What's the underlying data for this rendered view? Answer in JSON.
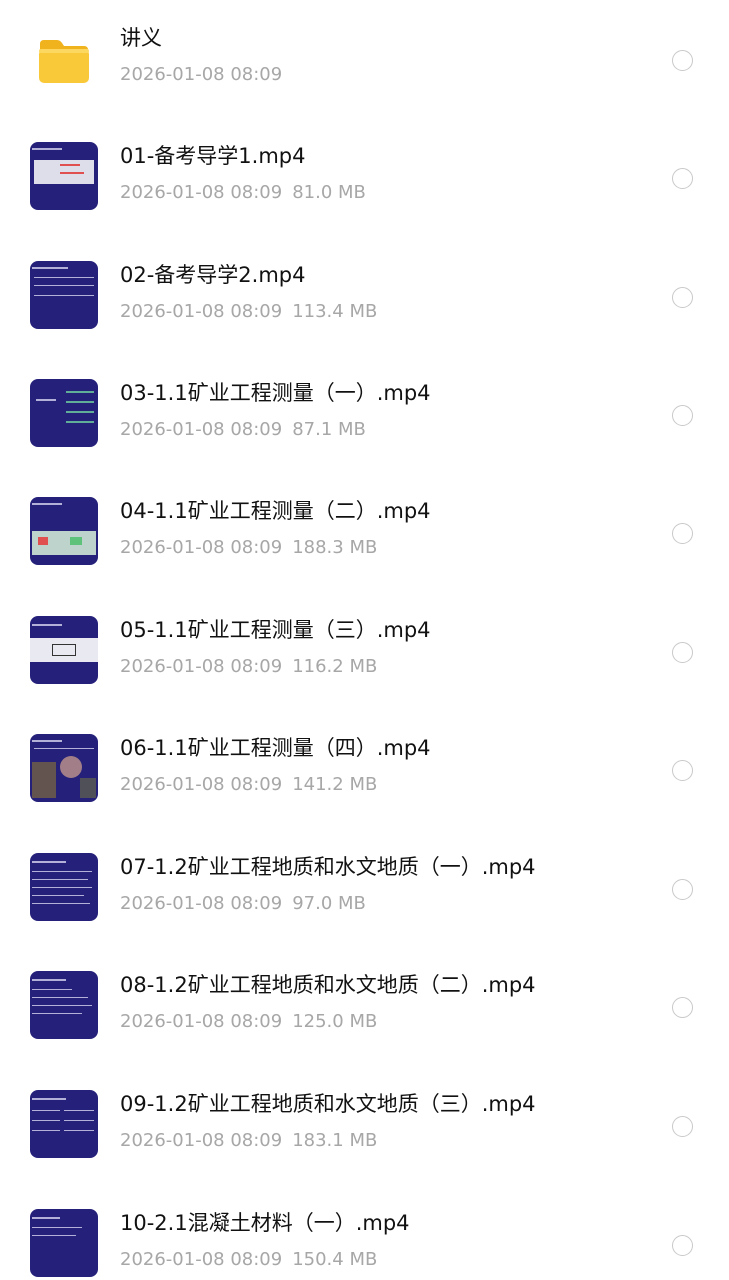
{
  "items": [
    {
      "name": "讲义",
      "date": "2026-01-08 08:09",
      "size": "",
      "type": "folder-icon"
    },
    {
      "name": "01-备考导学1.mp4",
      "date": "2026-01-08 08:09",
      "size": "81.0 MB",
      "type": "video-thumbnail"
    },
    {
      "name": "02-备考导学2.mp4",
      "date": "2026-01-08 08:09",
      "size": "113.4 MB",
      "type": "video-thumbnail"
    },
    {
      "name": "03-1.1矿业工程测量（一）.mp4",
      "date": "2026-01-08 08:09",
      "size": "87.1 MB",
      "type": "video-thumbnail"
    },
    {
      "name": "04-1.1矿业工程测量（二）.mp4",
      "date": "2026-01-08 08:09",
      "size": "188.3 MB",
      "type": "video-thumbnail"
    },
    {
      "name": "05-1.1矿业工程测量（三）.mp4",
      "date": "2026-01-08 08:09",
      "size": "116.2 MB",
      "type": "video-thumbnail"
    },
    {
      "name": "06-1.1矿业工程测量（四）.mp4",
      "date": "2026-01-08 08:09",
      "size": "141.2 MB",
      "type": "video-thumbnail"
    },
    {
      "name": "07-1.2矿业工程地质和水文地质（一）.mp4",
      "date": "2026-01-08 08:09",
      "size": "97.0 MB",
      "type": "video-thumbnail"
    },
    {
      "name": "08-1.2矿业工程地质和水文地质（二）.mp4",
      "date": "2026-01-08 08:09",
      "size": "125.0 MB",
      "type": "video-thumbnail"
    },
    {
      "name": "09-1.2矿业工程地质和水文地质（三）.mp4",
      "date": "2026-01-08 08:09",
      "size": "183.1 MB",
      "type": "video-thumbnail"
    },
    {
      "name": "10-2.1混凝土材料（一）.mp4",
      "date": "2026-01-08 08:09",
      "size": "150.4 MB",
      "type": "video-thumbnail"
    }
  ],
  "colors": {
    "title": "#111111",
    "meta": "#a7a7a7",
    "thumbnail_bg": "#25217a",
    "folder": "#f8c534",
    "radio_border": "#c9c9c9"
  }
}
